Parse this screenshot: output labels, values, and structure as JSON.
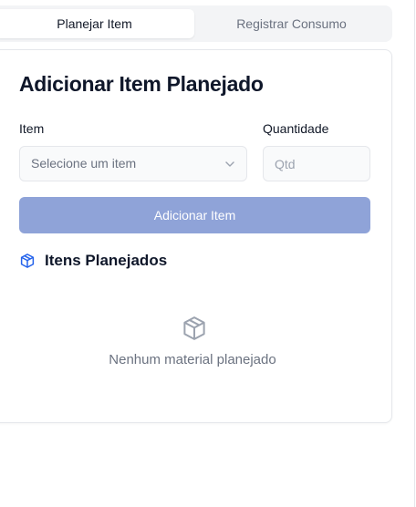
{
  "tabs": {
    "plan_label": "Planejar Item",
    "consume_label": "Registrar Consumo"
  },
  "card": {
    "title": "Adicionar Item Planejado",
    "item_label": "Item",
    "item_placeholder": "Selecione um item",
    "quantity_label": "Quantidade",
    "quantity_placeholder": "Qtd",
    "add_button_label": "Adicionar Item"
  },
  "planned": {
    "title": "Itens Planejados",
    "empty_text": "Nenhum material planejado",
    "icon": "package-icon"
  },
  "colors": {
    "accent": "#2563eb",
    "button_disabled": "#8fa3d8",
    "muted_text": "#6b7280",
    "empty_icon": "#9ca3af"
  }
}
